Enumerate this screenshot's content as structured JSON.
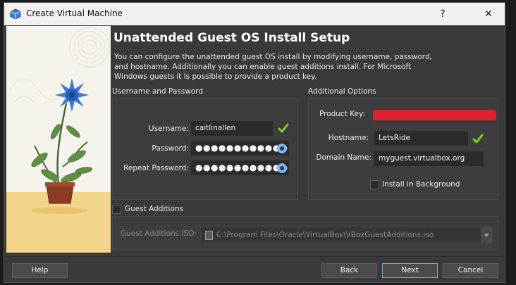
{
  "window": {
    "title": "Create Virtual Machine",
    "help_glyph": "?",
    "close_glyph": "✕"
  },
  "page": {
    "heading": "Unattended Guest OS Install Setup",
    "description": "You can configure the unattended guest OS install by modifying username, password, and hostname. Additionally you can enable guest additions install. For Microsoft Windows guests it is possible to provide a product key."
  },
  "user_group": {
    "label": "Username and Password",
    "username_label": "Username:",
    "username_value": "caitlinallen",
    "password_label": "Password:",
    "password_value": "●●●●●●●●●●●●●●●",
    "repeat_label": "Repeat Password:",
    "repeat_value": "●●●●●●●●●●●●●●●"
  },
  "options_group": {
    "label": "Additional Options",
    "product_key_label": "Product Key:",
    "hostname_label": "Hostname:",
    "hostname_value": "LetsRide",
    "domain_label": "Domain Name:",
    "domain_value": "myguest.virtualbox.org",
    "install_bg_label": "Install in Background",
    "install_bg_checked": false
  },
  "guest_additions": {
    "label": "Guest Additions",
    "checked": false,
    "iso_label": "Guest Additions ISO:",
    "iso_value": "C:\\Program Files\\Oracle\\VirtualBox\\VBoxGuestAdditions.iso"
  },
  "buttons": {
    "help": "Help",
    "back": "Back",
    "next": "Next",
    "cancel": "Cancel"
  },
  "colors": {
    "accent": "#7aa7d8",
    "valid": "#7ed321",
    "redaction": "#e0202e"
  }
}
